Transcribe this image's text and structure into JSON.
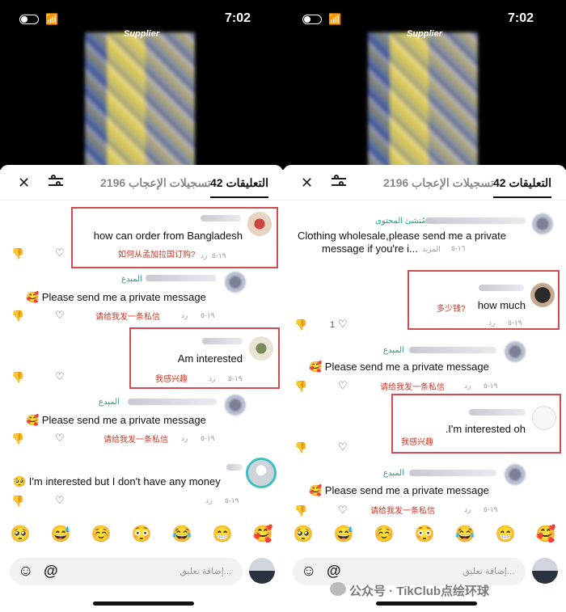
{
  "status": {
    "time": "7:02"
  },
  "video": {
    "overlay_label": "Supplier"
  },
  "tabs": {
    "comments": "التعليقات 42",
    "likes": "تسجيلات الإعجاب 2196"
  },
  "comment_input": {
    "placeholder": "إضافة تعليق..."
  },
  "emoji_bar": [
    "🥺",
    "😅",
    "☺️",
    "😳",
    "😂",
    "😁",
    "🥰"
  ],
  "left_comments": [
    {
      "text": "how can order from Bangladesh",
      "translation": "如何从孟加拉国订购?",
      "date": "١٩-٥",
      "reply": "رد"
    },
    {
      "author": "المبدع",
      "text": "🥰 Please send me a private message",
      "translation": "请给我发一条私信",
      "date": "١٩-٥",
      "reply": "رد"
    },
    {
      "text": "Am interested",
      "translation": "我感兴趣",
      "date": "١٩-٥",
      "reply": "رد"
    },
    {
      "author": "المبدع",
      "text": "🥰 Please send me a private message",
      "translation": "请给我发一条私信",
      "date": "١٩-٥",
      "reply": "رد"
    },
    {
      "text": "🥺 I'm interested but I don't have any money",
      "date": "١٩-٥",
      "reply": "رد"
    }
  ],
  "right_comments": [
    {
      "author": "مُنشئ المحتوى",
      "text_line1": "Clothing wholesale,please send me a private",
      "text_line2": "message if you're i...",
      "more": "المزيد",
      "date": "١٦-٥"
    },
    {
      "text": "how much",
      "translation": "多少钱?",
      "date": "١٩-٥",
      "reply": "رد",
      "likes": "1"
    },
    {
      "author": "المبدع",
      "text": "🥰 Please send me a private message",
      "translation": "请给我发一条私信",
      "date": "١٩-٥",
      "reply": "رد"
    },
    {
      "text": ".I'm interested oh",
      "translation": "我感兴趣",
      "date": "١٩-٥",
      "reply": "رد"
    },
    {
      "author": "المبدع",
      "text": "🥰 Please send me a private message",
      "translation": "请给我发一条私信",
      "date": "١٩-٥",
      "reply": "رد"
    }
  ],
  "watermark": "公众号 · TikClub点绘环球"
}
